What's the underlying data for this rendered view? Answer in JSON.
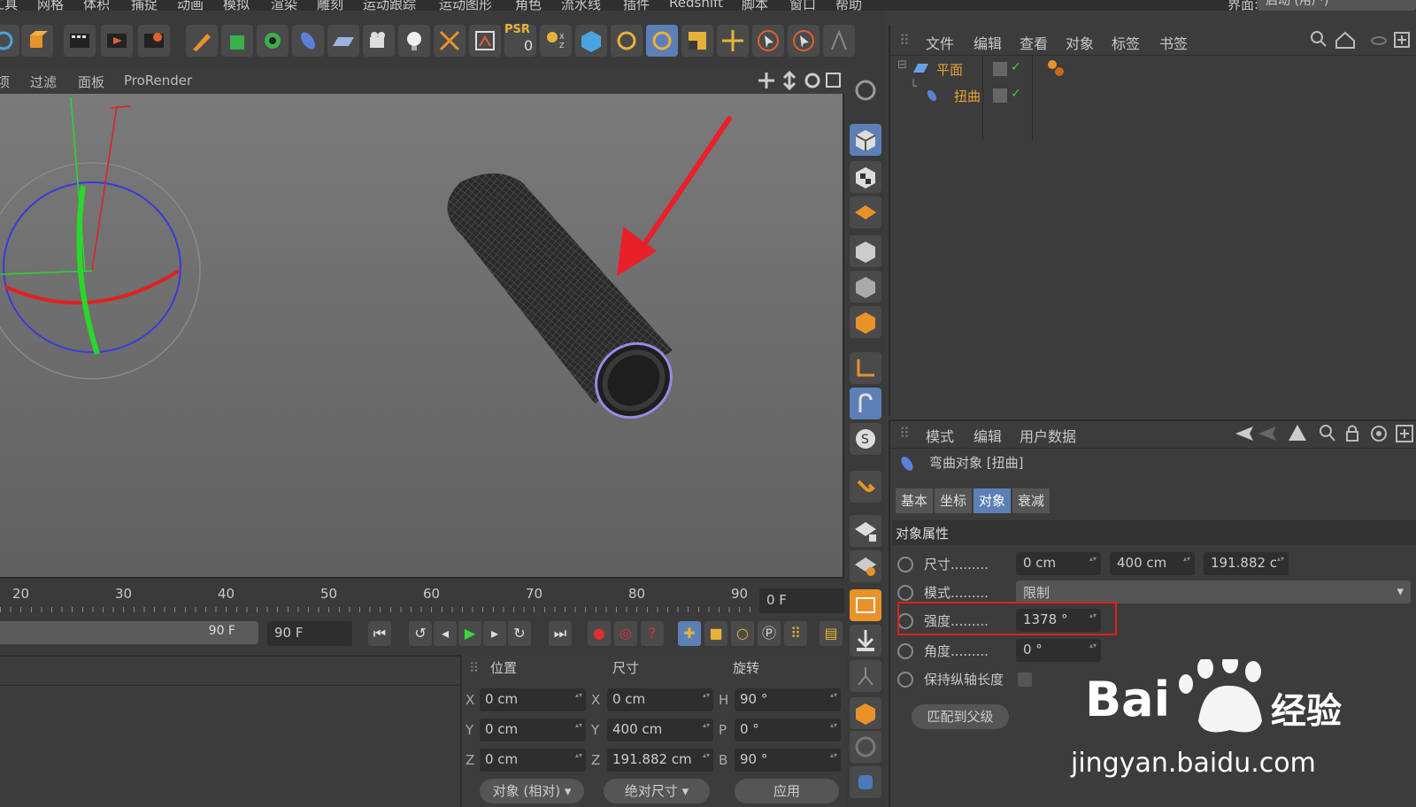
{
  "menubar": {
    "items": [
      "工具",
      "网格",
      "体积",
      "捕捉",
      "动画",
      "模拟",
      "渲染",
      "雕刻",
      "运动跟踪",
      "运动图形",
      "角色",
      "流水线",
      "插件",
      "Redshift",
      "脚本",
      "窗口",
      "帮助"
    ],
    "ui_label": "界面:",
    "ui_value": "启动 (用户)"
  },
  "toolbar": {
    "psr_label": "PSR",
    "psr_value": "0"
  },
  "viewport": {
    "menu": [
      "项",
      "过滤",
      "面板",
      "ProRender"
    ]
  },
  "timeline": {
    "ticks": [
      "20",
      "30",
      "40",
      "50",
      "60",
      "70",
      "80",
      "90"
    ],
    "current_frame": "0 F",
    "range_end": "90 F",
    "end_frame": "90 F"
  },
  "coordinates": {
    "headers": {
      "position": "位置",
      "size": "尺寸",
      "rotation": "旋转"
    },
    "rows": [
      {
        "axis": "X",
        "pos": "0 cm",
        "size_axis": "X",
        "size": "0 cm",
        "rot_axis": "H",
        "rot": "90 °"
      },
      {
        "axis": "Y",
        "pos": "0 cm",
        "size_axis": "Y",
        "size": "400 cm",
        "rot_axis": "P",
        "rot": "0 °"
      },
      {
        "axis": "Z",
        "pos": "0 cm",
        "size_axis": "Z",
        "size": "191.882 cm",
        "rot_axis": "B",
        "rot": "90 °"
      }
    ],
    "mode_select": "对象 (相对)",
    "size_select": "绝对尺寸",
    "apply_button": "应用"
  },
  "object_manager": {
    "menu": [
      "文件",
      "编辑",
      "查看",
      "对象",
      "标签",
      "书签"
    ],
    "objects": [
      {
        "name": "平面",
        "level": 0
      },
      {
        "name": "扭曲",
        "level": 1
      }
    ]
  },
  "attribute_manager": {
    "menu": [
      "模式",
      "编辑",
      "用户数据"
    ],
    "object_title": "弯曲对象 [扭曲]",
    "tabs": [
      "基本",
      "坐标",
      "对象",
      "衰减"
    ],
    "active_tab": "对象",
    "section_title": "对象属性",
    "size_label": "尺寸.........",
    "size_values": [
      "0 cm",
      "400 cm",
      "191.882 c"
    ],
    "mode_label": "模式.........",
    "mode_value": "限制",
    "strength_label": "强度.........",
    "strength_value": "1378 °",
    "angle_label": "角度.........",
    "angle_value": "0 °",
    "keep_length_label": "保持纵轴长度",
    "match_parent_button": "匹配到父级"
  },
  "watermark": {
    "brand": "Bai",
    "brand_cn": "经验",
    "url": "jingyan.baidu.com"
  },
  "colors": {
    "accent": "#5c7fb6",
    "object_name": "#e8a23a",
    "highlight": "#e02020",
    "arrow": "#e8202a"
  }
}
